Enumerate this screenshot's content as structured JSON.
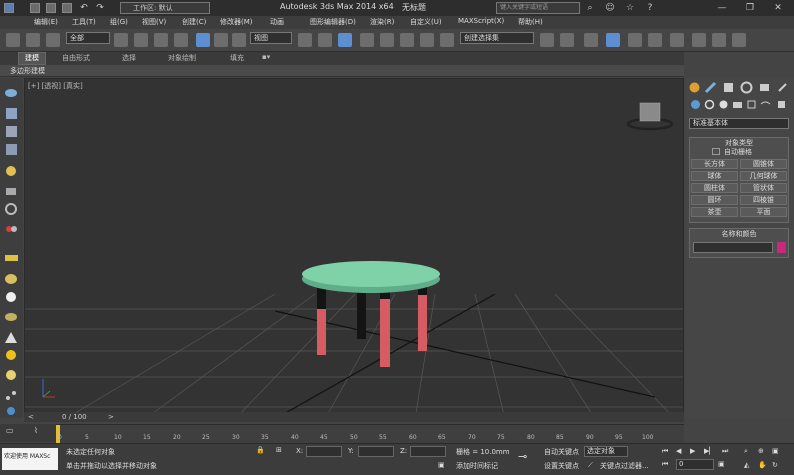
{
  "titlebar": {
    "workspace_label": "工作区: 默认",
    "app_title": "Autodesk 3ds Max  2014 x64",
    "doc_title": "无标题",
    "search_placeholder": "键入关键字或短语"
  },
  "menu": [
    "编辑(E)",
    "工具(T)",
    "组(G)",
    "视图(V)",
    "创建(C)",
    "修改器(M)",
    "动画",
    "图形编辑器(D)",
    "渲染(R)",
    "自定义(U)",
    "MAXScript(X)",
    "帮助(H)"
  ],
  "toolbar": {
    "filter_value": "全部",
    "refcoord_value": "视图",
    "selset_value": "创建选择集"
  },
  "ribbon": {
    "tabs": [
      "建模",
      "自由形式",
      "选择",
      "对象绘制",
      "填充"
    ],
    "active_tab": "建模",
    "subtitle": "多边形建模"
  },
  "viewport": {
    "label": "[+] [透视] [真实]",
    "colors": {
      "tabletop": "#7fd1a8",
      "leg_bottom": "#d65c63",
      "leg_top": "#141414",
      "grid": "#555555"
    }
  },
  "command_panel": {
    "category_value": "标准基本体",
    "object_type_title": "对象类型",
    "autogrid_label": "自动栅格",
    "object_buttons": [
      "长方体",
      "圆锥体",
      "球体",
      "几何球体",
      "圆柱体",
      "管状体",
      "圆环",
      "四棱锥",
      "茶壶",
      "平面"
    ],
    "name_color_title": "名称和颜色",
    "object_color": "#c8287e"
  },
  "timeline": {
    "frame_label": "0 / 100",
    "ticks": [
      "0",
      "5",
      "10",
      "15",
      "20",
      "25",
      "30",
      "35",
      "40",
      "45",
      "50",
      "55",
      "60",
      "65",
      "70",
      "75",
      "80",
      "85",
      "90",
      "95",
      "100"
    ]
  },
  "status": {
    "maxscript_label": "欢迎使用 MAXSc",
    "selection_status": "未选定任何对象",
    "prompt": "单击并拖动以选择并移动对象",
    "x_label": "X:",
    "y_label": "Y:",
    "z_label": "Z:",
    "grid_label": "栅格 = 10.0mm",
    "add_time_tag": "添加时间标记",
    "autokey_label": "自动关键点",
    "selected_value": "选定对象",
    "setkey_label": "设置关键点",
    "keyfilter_label": "关键点过滤器...",
    "frame_value": "0"
  }
}
